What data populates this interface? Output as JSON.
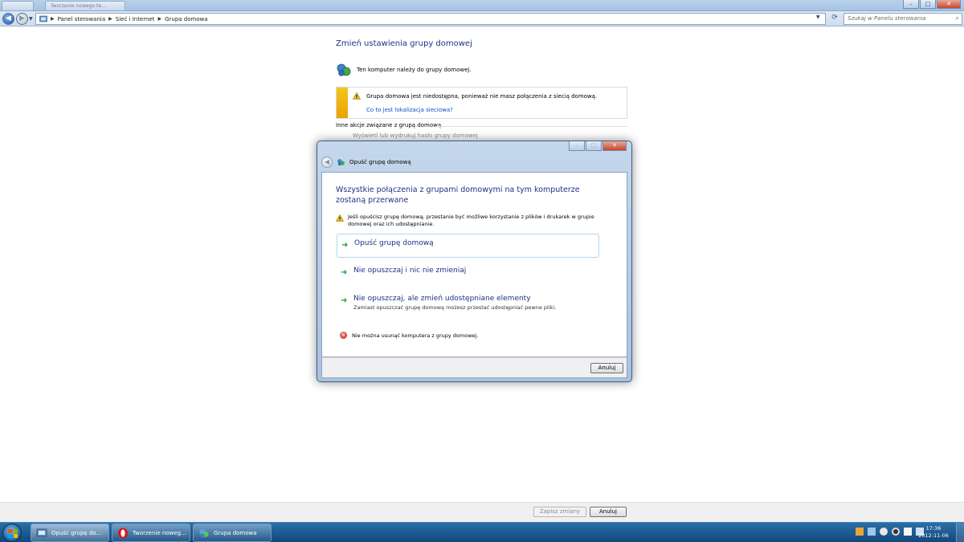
{
  "titlebar": {
    "tab_left": "",
    "tab_title": "Tworzenie nowego te...",
    "minimize": "–",
    "maximize": "□",
    "close": "✕"
  },
  "addressbar": {
    "breadcrumbs": [
      "Panel sterowania",
      "Sieć i Internet",
      "Grupa domowa"
    ],
    "search_placeholder": "Szukaj w Panelu sterowania"
  },
  "content": {
    "title": "Zmień ustawienia grupy domowej",
    "member_text": "Ten komputer należy do grupy domowej.",
    "warning_text": "Grupa domowa jest niedostępna, ponieważ nie masz połączenia z siecią domową.",
    "warning_link": "Co to jest lokalizacja sieciowa?",
    "other_actions_heading": "Inne akcje związane z grupą domową",
    "other_action_1": "Wyświetl lub wydrukuj hasło grupy domowej"
  },
  "bottombar": {
    "save_label": "Zapisz zmiany",
    "cancel_label": "Anuluj"
  },
  "dialog": {
    "title": "Opuść grupę domową",
    "question": "Wszystkie połączenia z grupami domowymi na tym komputerze zostaną przerwane",
    "warning": "Jeśli opuścisz grupę domową, przestanie być możliwe korzystanie z plików i drukarek w grupie domowej oraz ich udostępnianie.",
    "options": [
      {
        "label": "Opuść grupę domową",
        "sub": ""
      },
      {
        "label": "Nie opuszczaj i nic nie zmieniaj",
        "sub": ""
      },
      {
        "label": "Nie opuszczaj, ale zmień udostępniane elementy",
        "sub": "Zamiast opuszczać grupę domową możesz przestać udostępniać pewne pliki."
      }
    ],
    "error": "Nie można usunąć komputera z grupy domowej.",
    "cancel_label": "Anuluj"
  },
  "taskbar": {
    "tasks": [
      "Opuść grupę do...",
      "Tworzenie noweg...",
      "Grupa domowa"
    ],
    "time": "17:36",
    "date": "2012-11-06"
  },
  "colors": {
    "accent_blue": "#1e3287",
    "link_blue": "#0a54c7",
    "warning_stripe": "#f6c51f",
    "arrow_green": "#23a03a",
    "taskbar": "#13477b"
  },
  "icons": [
    "homegroup-icon",
    "warning-icon",
    "arrow-right-icon",
    "error-icon",
    "search-icon",
    "windows-logo-icon",
    "opera-icon"
  ]
}
